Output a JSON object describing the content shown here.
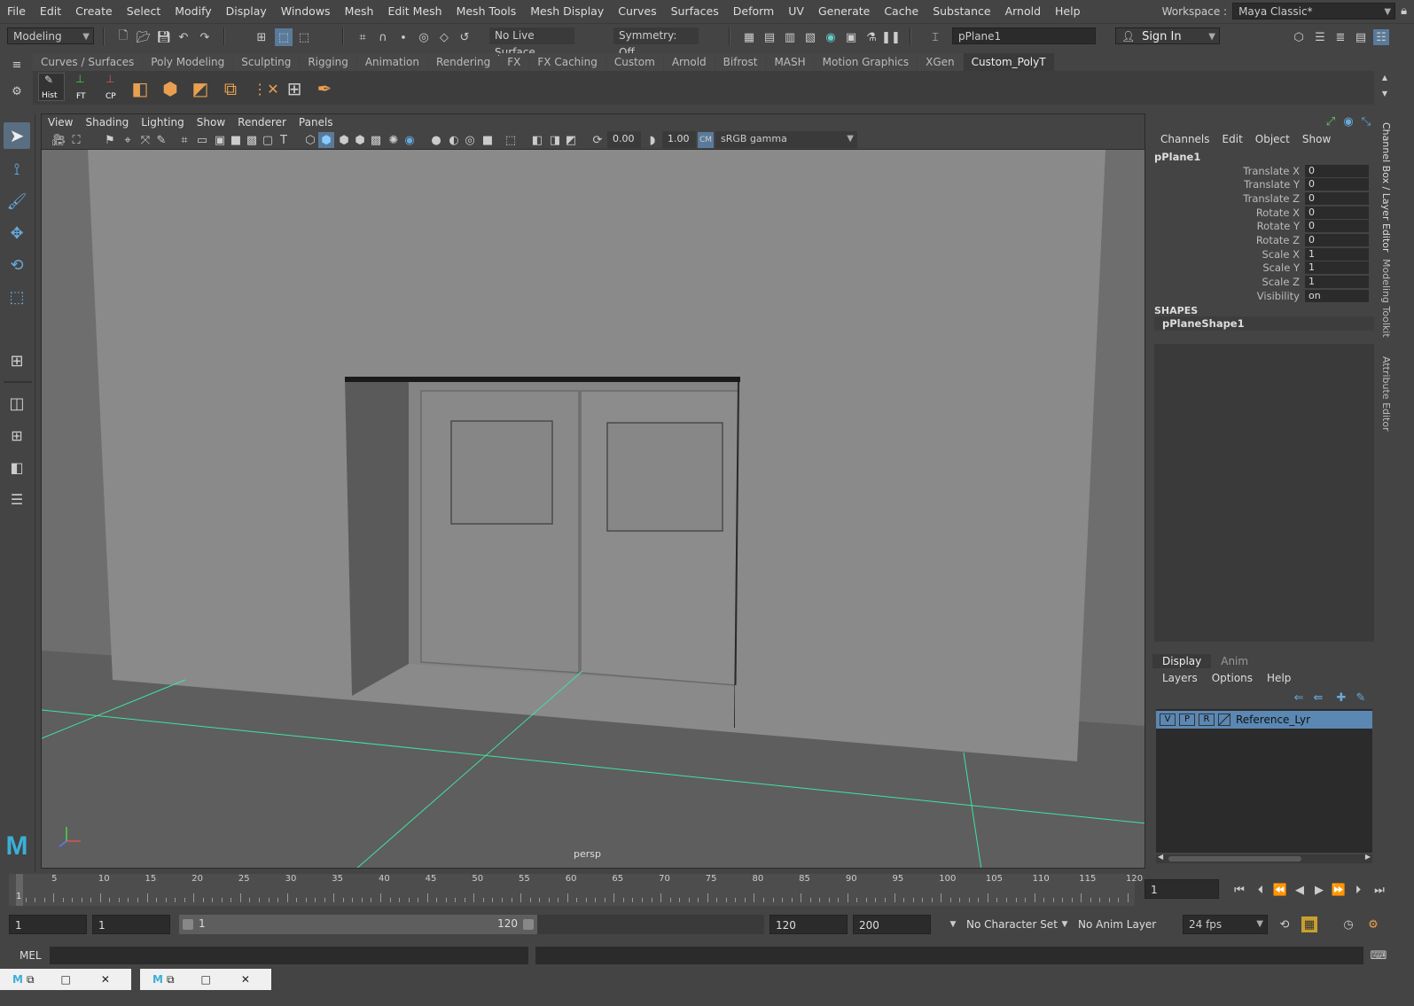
{
  "menubar": {
    "items": [
      "File",
      "Edit",
      "Create",
      "Select",
      "Modify",
      "Display",
      "Windows",
      "Mesh",
      "Edit Mesh",
      "Mesh Tools",
      "Mesh Display",
      "Curves",
      "Surfaces",
      "Deform",
      "UV",
      "Generate",
      "Cache",
      "Substance",
      "Arnold",
      "Help"
    ],
    "workspace_label": "Workspace :",
    "workspace_value": "Maya Classic*"
  },
  "statusline": {
    "mode": "Modeling",
    "live_surface": "No Live Surface",
    "symmetry": "Symmetry: Off",
    "object_name": "pPlane1",
    "sign_in": "Sign In"
  },
  "shelf": {
    "tabs": [
      "Curves / Surfaces",
      "Poly Modeling",
      "Sculpting",
      "Rigging",
      "Animation",
      "Rendering",
      "FX",
      "FX Caching",
      "Custom",
      "Arnold",
      "Bifrost",
      "MASH",
      "Motion Graphics",
      "XGen",
      "Custom_PolyT"
    ],
    "active_tab": "Custom_PolyT",
    "buttons": [
      "Hist",
      "FT",
      "CP"
    ]
  },
  "viewport": {
    "menu": [
      "View",
      "Shading",
      "Lighting",
      "Show",
      "Renderer",
      "Panels"
    ],
    "exposure": "0.00",
    "gamma": "1.00",
    "color_space": "sRGB gamma",
    "camera_label": "persp"
  },
  "channelbox": {
    "menu": [
      "Channels",
      "Edit",
      "Object",
      "Show"
    ],
    "object": "pPlane1",
    "attributes": [
      {
        "label": "Translate X",
        "value": "0"
      },
      {
        "label": "Translate Y",
        "value": "0"
      },
      {
        "label": "Translate Z",
        "value": "0"
      },
      {
        "label": "Rotate X",
        "value": "0"
      },
      {
        "label": "Rotate Y",
        "value": "0"
      },
      {
        "label": "Rotate Z",
        "value": "0"
      },
      {
        "label": "Scale X",
        "value": "1"
      },
      {
        "label": "Scale Y",
        "value": "1"
      },
      {
        "label": "Scale Z",
        "value": "1"
      },
      {
        "label": "Visibility",
        "value": "on"
      }
    ],
    "shapes_header": "SHAPES",
    "shape_name": "pPlaneShape1"
  },
  "side_tabs": [
    "Channel Box / Layer Editor",
    "Modeling Toolkit",
    "Attribute Editor"
  ],
  "layer_editor": {
    "tabs": [
      "Display",
      "Anim"
    ],
    "active_tab": "Display",
    "menu": [
      "Layers",
      "Options",
      "Help"
    ],
    "layers": [
      {
        "v": "V",
        "p": "P",
        "r": "R",
        "name": "Reference_Lyr"
      }
    ]
  },
  "timeline": {
    "ticks": [
      "5",
      "10",
      "15",
      "20",
      "25",
      "30",
      "35",
      "40",
      "45",
      "50",
      "55",
      "60",
      "65",
      "70",
      "75",
      "80",
      "85",
      "90",
      "95",
      "100",
      "105",
      "110",
      "115",
      "120"
    ],
    "current_frame_marker": "1",
    "current_frame": "1"
  },
  "range": {
    "start": "1",
    "playback_start": "1",
    "slider_start": "1",
    "slider_end": "120",
    "playback_end": "120",
    "end": "200",
    "character_set": "No Character Set",
    "anim_layer": "No Anim Layer",
    "fps": "24 fps"
  },
  "cmdline": {
    "language": "MEL"
  },
  "colors": {
    "grid_axis": "#3fe3a0",
    "selection": "#5a8ab5",
    "layer_row": "#5b87b3"
  }
}
